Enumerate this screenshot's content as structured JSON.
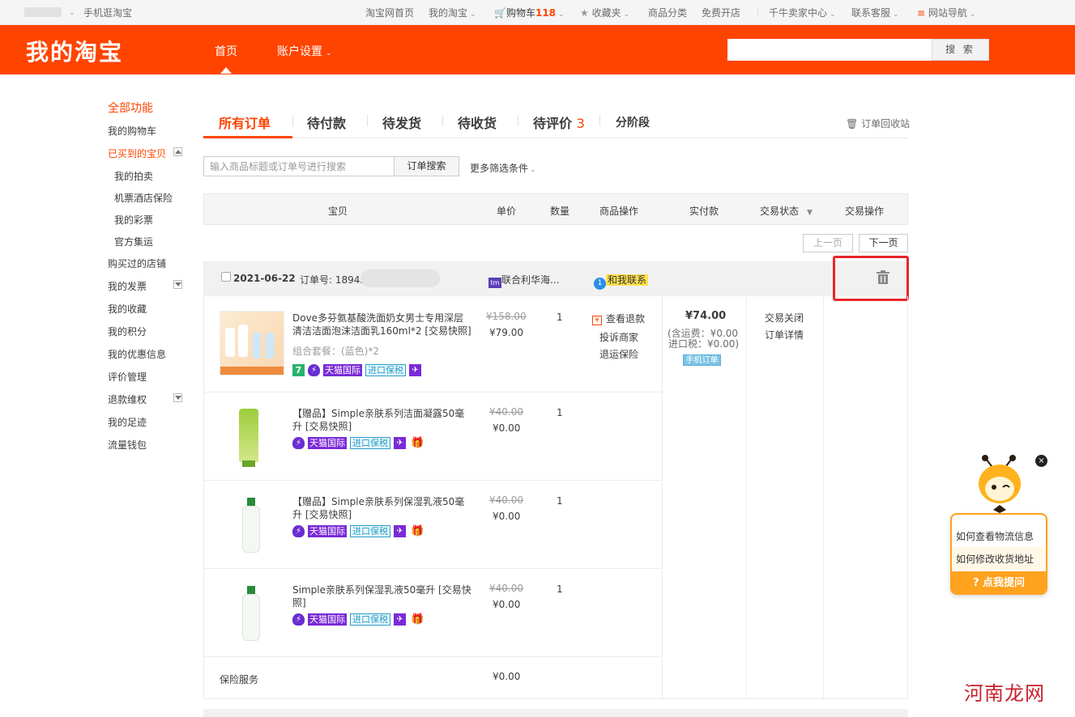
{
  "topbar": {
    "user": "",
    "mobile": "手机逛淘宝",
    "home": "淘宝网首页",
    "my_taobao": "我的淘宝",
    "cart_label": "购物车",
    "cart_count": "118",
    "favorites": "收藏夹",
    "categories": "商品分类",
    "open_shop": "免费开店",
    "seller_center": "千牛卖家中心",
    "service": "联系客服",
    "site_nav": "网站导航"
  },
  "header": {
    "logo": "我的淘宝",
    "nav_home": "首页",
    "nav_account": "账户设置",
    "search_placeholder": "",
    "search_button": "搜 索"
  },
  "sidebar": {
    "title": "全部功能",
    "items": [
      "我的购物车",
      "已买到的宝贝",
      "我的拍卖",
      "机票酒店保险",
      "我的彩票",
      "官方集运",
      "购买过的店铺",
      "我的发票",
      "我的收藏",
      "我的积分",
      "我的优惠信息",
      "评价管理",
      "退款维权",
      "我的足迹",
      "流量钱包"
    ]
  },
  "tabs": {
    "all": "所有订单",
    "pending_pay": "待付款",
    "pending_ship": "待发货",
    "pending_receive": "待收货",
    "pending_review": "待评价",
    "review_count": "3",
    "installment": "分阶段",
    "recycle_bin": "订单回收站"
  },
  "order_search": {
    "placeholder": "输入商品标题或订单号进行搜索",
    "button": "订单搜索",
    "more_filters": "更多筛选条件"
  },
  "table_header": {
    "item": "宝贝",
    "unit_price": "单价",
    "quantity": "数量",
    "item_ops": "商品操作",
    "paid": "实付款",
    "status": "交易状态",
    "trade_ops": "交易操作"
  },
  "pagination": {
    "prev": "上一页",
    "next": "下一页"
  },
  "order": {
    "date": "2021-06-22",
    "order_no_label": "订单号: 18945",
    "shop": "联合利华海...",
    "contact": "和我联系",
    "products": [
      {
        "name": "Dove多芬氨基酸洗面奶女男士专用深层清洁洁面泡沫洁面乳160ml*2 [交易快照]",
        "sku": "组合套餐：(蓝色)*2",
        "old_price": "¥158.00",
        "price": "¥79.00",
        "qty": "1"
      },
      {
        "name": "【赠品】Simple亲肤系列洁面凝露50毫升 [交易快照]",
        "old_price": "¥40.00",
        "price": "¥0.00",
        "qty": "1"
      },
      {
        "name": "【赠品】Simple亲肤系列保湿乳液50毫升 [交易快照]",
        "old_price": "¥40.00",
        "price": "¥0.00",
        "qty": "1"
      },
      {
        "name": "Simple亲肤系列保湿乳液50毫升 [交易快照]",
        "old_price": "¥40.00",
        "price": "¥0.00",
        "qty": "1"
      }
    ],
    "badges": {
      "tmall_intl": "天猫国际",
      "bonded": "进口保税",
      "seven": "7"
    },
    "item_ops": {
      "refund": "查看退款",
      "complain": "投诉商家",
      "return_insurance": "退运保险"
    },
    "paid": {
      "total": "¥74.00",
      "shipping": "(含运费：¥0.00",
      "tax": "进口税：¥0.00)",
      "mobile_order": "手机订单"
    },
    "status": {
      "closed": "交易关闭",
      "details": "订单详情"
    },
    "insurance": {
      "label": "保险服务",
      "price": "¥0.00"
    }
  },
  "assistant": {
    "q1": "如何查看物流信息",
    "q2": "如何修改收货地址",
    "ask": "点我提问"
  },
  "watermark": "河南龙网",
  "colors": {
    "brand": "#ff4400",
    "highlight_box": "#e8262a"
  }
}
